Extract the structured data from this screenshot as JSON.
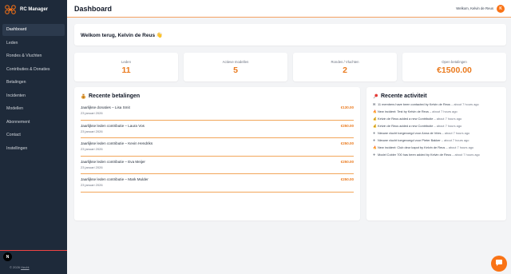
{
  "brand": {
    "name": "RC Manager"
  },
  "sidebar": {
    "items": [
      {
        "label": "Dashboard",
        "active": true
      },
      {
        "label": "Leden"
      },
      {
        "label": "Rondes & Vluchten"
      },
      {
        "label": "Contributies & Donaties"
      },
      {
        "label": "Betalingen"
      },
      {
        "label": "Incidenten"
      },
      {
        "label": "Modellen"
      },
      {
        "label": "Abonnement"
      },
      {
        "label": "Contact"
      },
      {
        "label": "Instellingen"
      }
    ],
    "badge": "N",
    "copyright_prefix": "© 2026 ",
    "copyright_link": "Hecht"
  },
  "header": {
    "title": "Dashboard",
    "welcome_text": "Welkom, Kelvin de Reus",
    "avatar_initial": "K"
  },
  "welcome": {
    "title": "Welkom terug, Kelvin de Reus 👋"
  },
  "stats": [
    {
      "label": "Leden",
      "value": "11"
    },
    {
      "label": "Actieve modellen",
      "value": "5"
    },
    {
      "label": "Rondes / Vluchten",
      "value": "2"
    },
    {
      "label": "Open betalingen",
      "value": "€1500.00"
    }
  ],
  "payments": {
    "title": "Recente betalingen",
    "rows": [
      {
        "desc": "Jaarlijkse donaties – Lisa Smit",
        "date": "23 januari 2026",
        "amount": "€130.00"
      },
      {
        "desc": "Jaarlijkse leden contributie – Laura Vos",
        "date": "23 januari 2026",
        "amount": "€250.00"
      },
      {
        "desc": "Jaarlijkse leden contributie – Kevin Hendriks",
        "date": "23 januari 2026",
        "amount": "€250.00"
      },
      {
        "desc": "Jaarlijkse leden contributie – Eva Meijer",
        "date": "23 januari 2026",
        "amount": "€250.00"
      },
      {
        "desc": "Jaarlijkse leden contributie – Mark Mulder",
        "date": "23 januari 2026",
        "amount": "€250.00"
      }
    ]
  },
  "activity": {
    "title": "Recente activiteit",
    "items": [
      {
        "icon": "✉",
        "text": "11 members have been contacted by Kelvin de Reus",
        "time": "– about 7 hours ago"
      },
      {
        "icon": "🔥",
        "text": "New incident: Test by Kelvin de Reus",
        "time": "– about 7 hours ago"
      },
      {
        "icon": "💰",
        "text": "Kelvin de Reus added a new Contributie",
        "time": "– about 7 hours ago"
      },
      {
        "icon": "💰",
        "text": "Kelvin de Reus added a new Contributie",
        "time": "– about 7 hours ago"
      },
      {
        "icon": "✈",
        "text": "Nieuwe vlucht toegevoegd voor Anna de Vries",
        "time": "– about 7 hours ago"
      },
      {
        "icon": "✈",
        "text": "Nieuwe vlucht toegevoegd voor Pieter Bakker",
        "time": "– about 7 hours ago"
      },
      {
        "icon": "🔥",
        "text": "New incident: Club deur kapot by Kelvin de Reus",
        "time": "– about 7 hours ago"
      },
      {
        "icon": "✈",
        "text": "Model Cobler 700 has been added by Kelvin de Reus",
        "time": "– about 7 hours ago"
      }
    ]
  },
  "colors": {
    "accent": "#f97316",
    "sidebar": "#1e2a3a",
    "value": "#ea7a1e"
  }
}
